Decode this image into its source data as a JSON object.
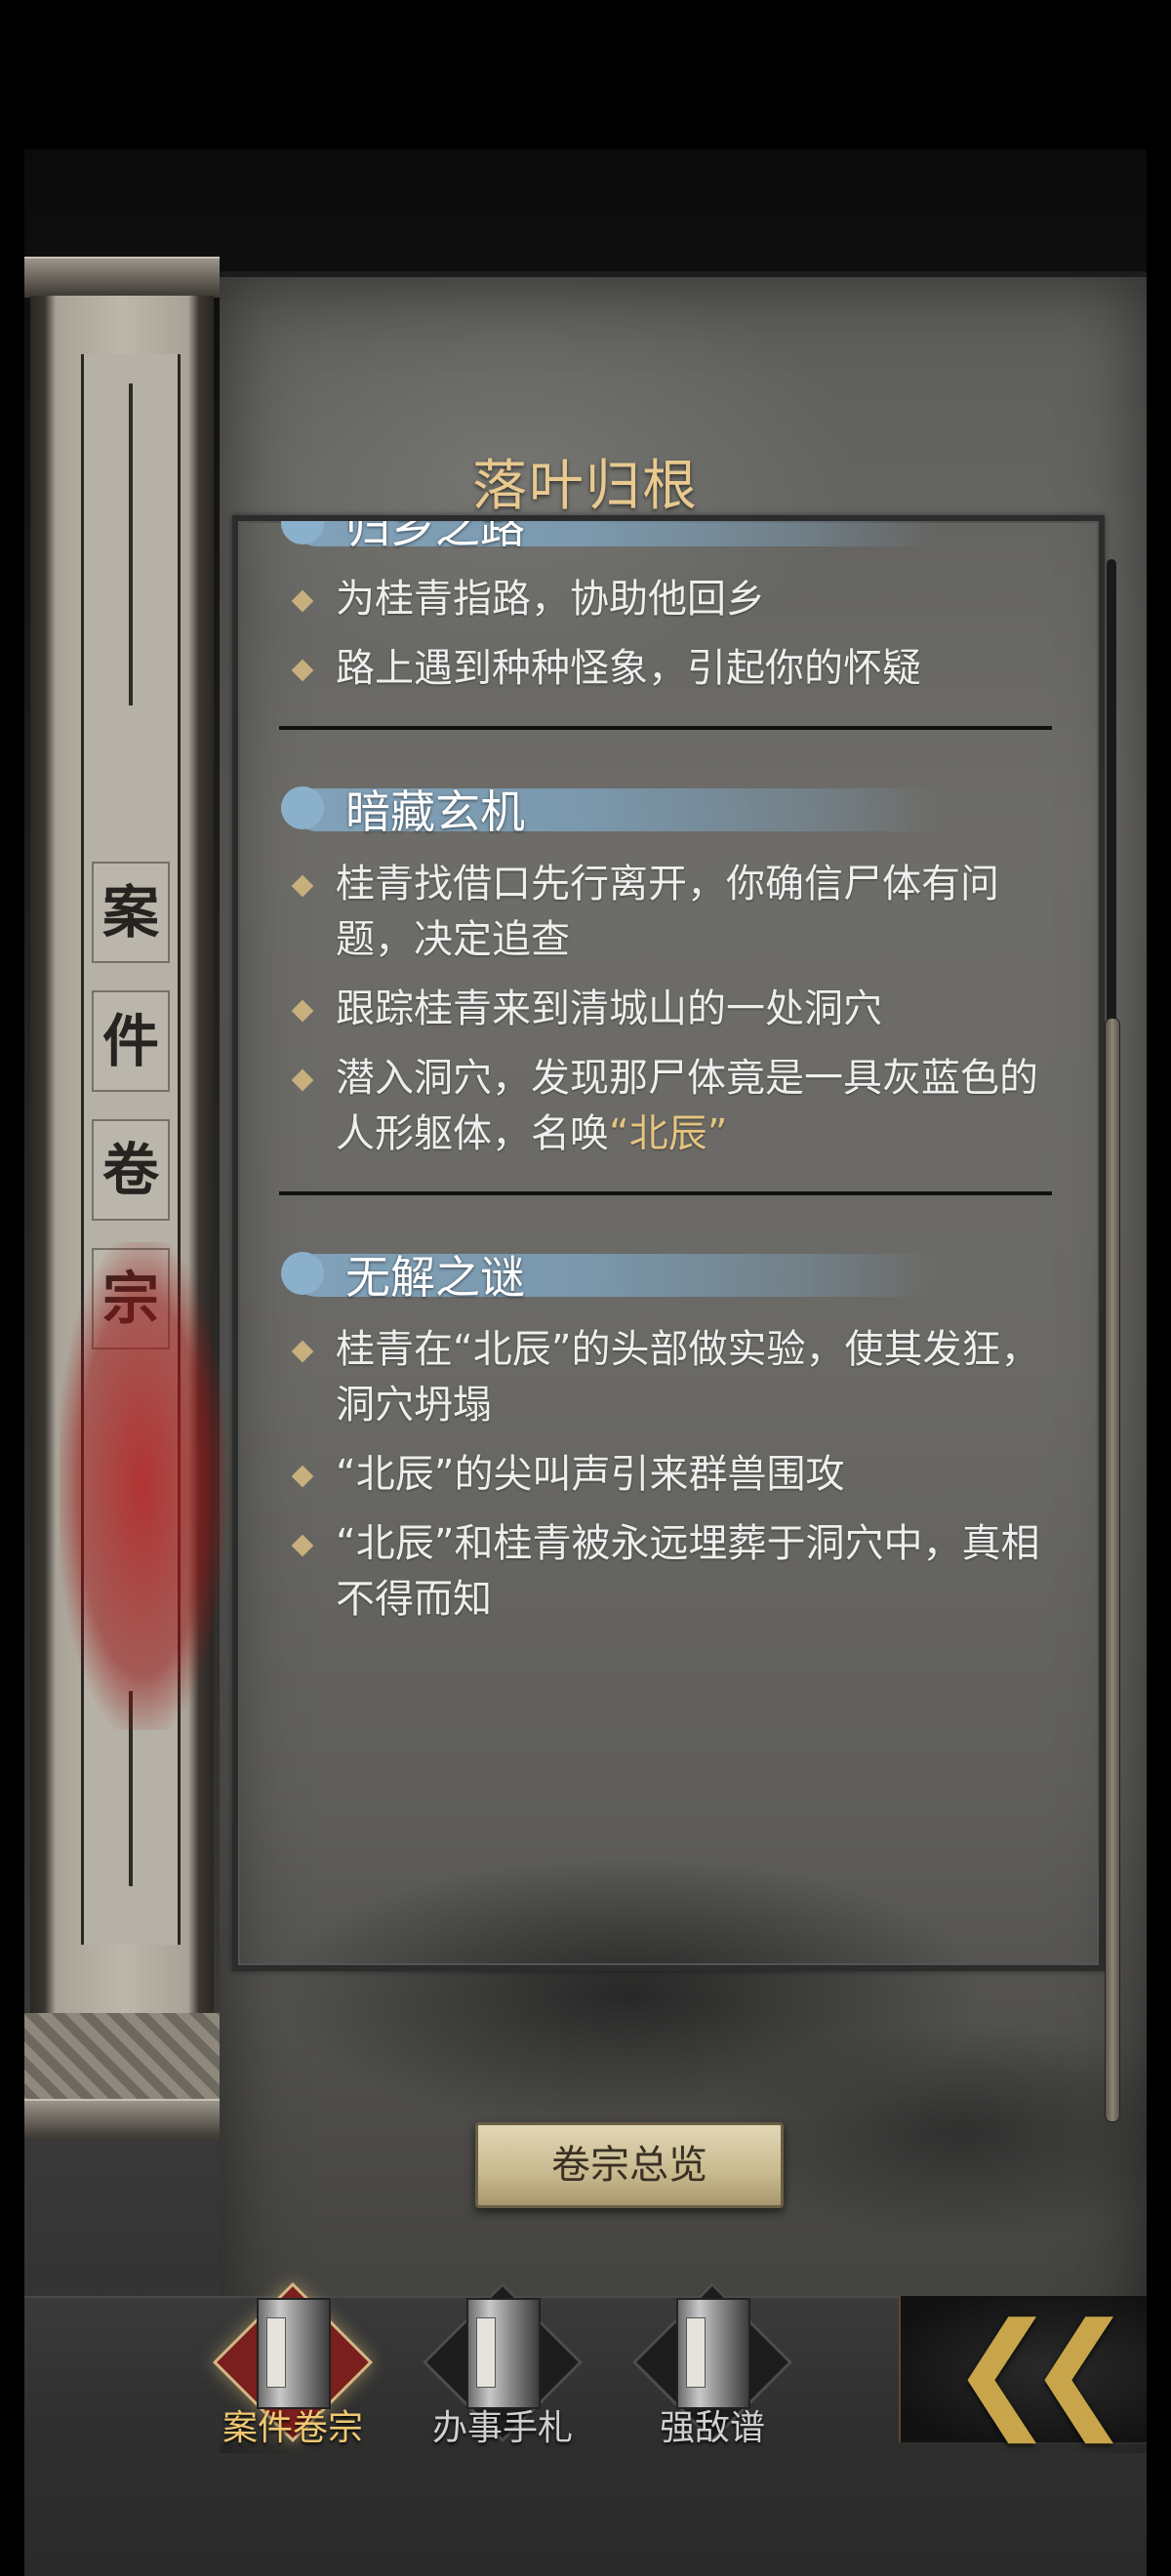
{
  "panel": {
    "title": "落叶归根"
  },
  "sections": [
    {
      "title": "归乡之路",
      "bullets": [
        "为桂青指路，协助他回乡",
        "路上遇到种种怪象，引起你的怀疑"
      ]
    },
    {
      "title": "暗藏玄机",
      "bullets": [
        "桂青找借口先行离开，你确信尸体有问题，决定追查",
        "跟踪桂青来到清城山的一处洞穴",
        "潜入洞穴，发现那尸体竟是一具灰蓝色的人形躯体，名唤"
      ],
      "highlight": "“北辰”"
    },
    {
      "title": "无解之谜",
      "bullets": [
        "桂青在“北辰”的头部做实验，使其发狂，洞穴坍塌",
        "“北辰”的尖叫声引来群兽围攻",
        "“北辰”和桂青被永远埋葬于洞穴中，真相不得而知"
      ]
    }
  ],
  "scroll_label": [
    "案",
    "件",
    "卷",
    "宗"
  ],
  "overview_button": {
    "label": "卷宗总览"
  },
  "nav": {
    "tabs": [
      {
        "label": "案件卷宗",
        "icon": "case-file-book-icon",
        "active": true
      },
      {
        "label": "办事手札",
        "icon": "handbook-icon",
        "active": false
      },
      {
        "label": "强敌谱",
        "icon": "enemy-register-icon",
        "active": false
      }
    ],
    "back_icon": "double-chevron-left-icon"
  },
  "colors": {
    "title": "#e8c98f",
    "highlight": "#e6c47f",
    "brush": "#7fa4c0",
    "active_label": "#f0c872"
  }
}
